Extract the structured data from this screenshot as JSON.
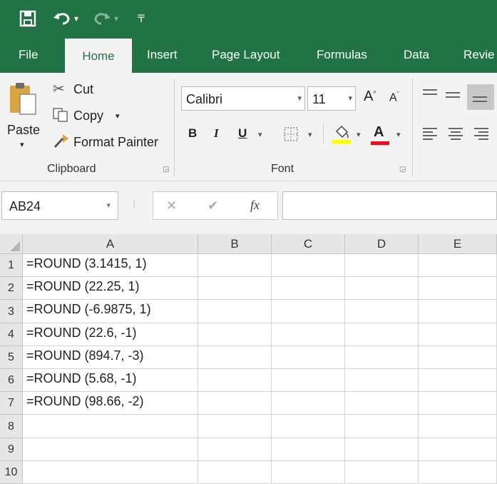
{
  "qat": {
    "save_icon": "save-icon",
    "undo_icon": "undo-icon",
    "redo_icon": "redo-icon",
    "customize_icon": "customize-icon"
  },
  "tabs": [
    {
      "label": "File"
    },
    {
      "label": "Home"
    },
    {
      "label": "Insert"
    },
    {
      "label": "Page Layout"
    },
    {
      "label": "Formulas"
    },
    {
      "label": "Data"
    },
    {
      "label": "Revie"
    }
  ],
  "clipboard": {
    "paste": "Paste",
    "cut": "Cut",
    "copy": "Copy",
    "format_painter": "Format Painter",
    "group_label": "Clipboard"
  },
  "font": {
    "name": "Calibri",
    "size": "11",
    "bold": "B",
    "italic": "I",
    "underline": "U",
    "fx_up": "A",
    "fx_down": "A",
    "color_letter": "A",
    "group_label": "Font"
  },
  "formula_bar": {
    "name_box": "AB24",
    "cancel": "✕",
    "enter": "✔",
    "fx": "fx",
    "value": ""
  },
  "columns": [
    "A",
    "B",
    "C",
    "D",
    "E"
  ],
  "rows": [
    {
      "num": "1",
      "a": "=ROUND (3.1415, 1)"
    },
    {
      "num": "2",
      "a": "=ROUND (22.25, 1)"
    },
    {
      "num": "3",
      "a": "=ROUND (-6.9875, 1)"
    },
    {
      "num": "4",
      "a": "=ROUND (22.6, -1)"
    },
    {
      "num": "5",
      "a": "=ROUND (894.7, -3)"
    },
    {
      "num": "6",
      "a": "=ROUND (5.68, -1)"
    },
    {
      "num": "7",
      "a": "=ROUND (98.66, -2)"
    },
    {
      "num": "8",
      "a": ""
    },
    {
      "num": "9",
      "a": ""
    },
    {
      "num": "10",
      "a": ""
    }
  ],
  "colors": {
    "brand": "#217346",
    "ribbon": "#f3f3f3",
    "font_color_bar": "#e81123",
    "highlight_bar": "#ffff00"
  }
}
